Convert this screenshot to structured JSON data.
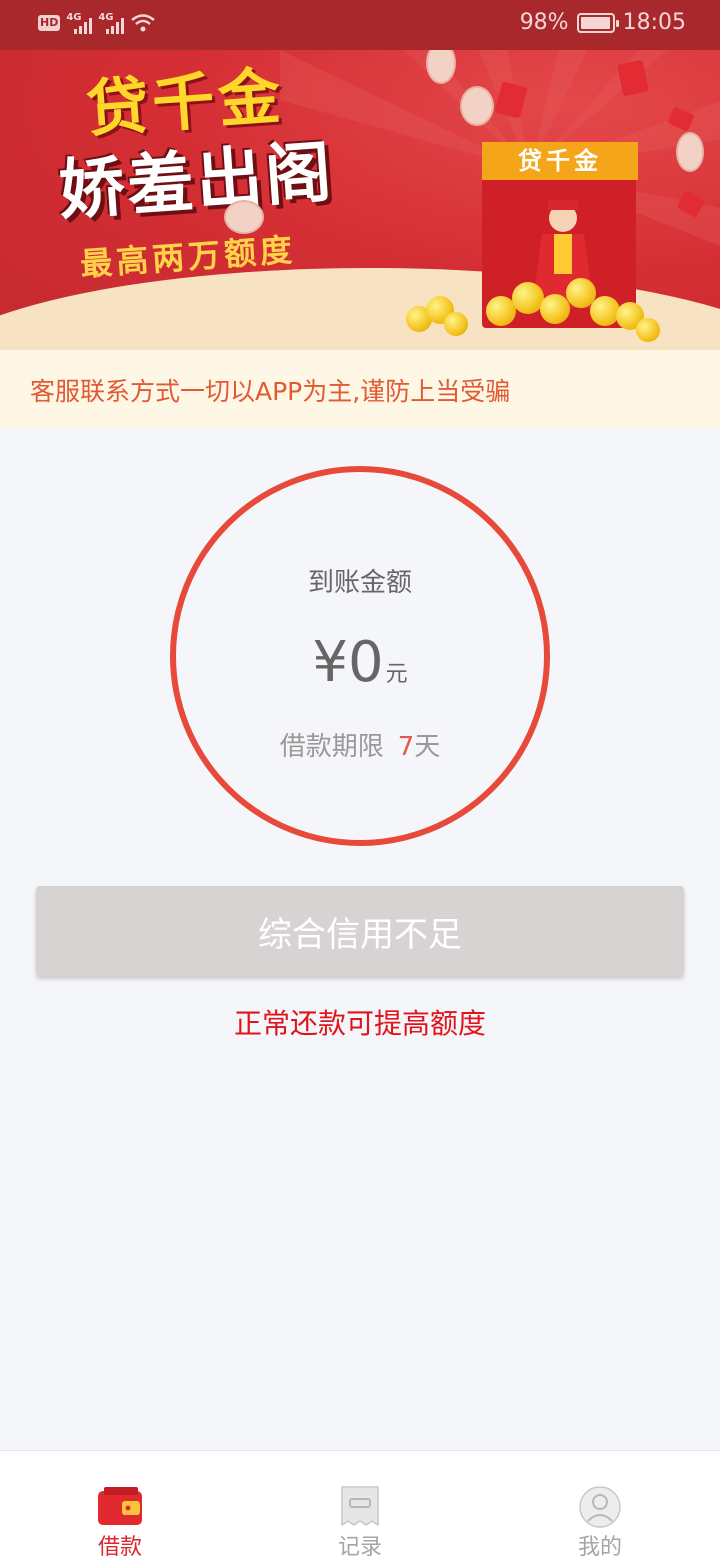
{
  "status_bar": {
    "hd_badge": "HD",
    "network_1": "4G",
    "network_2": "4G",
    "battery_percent": "98%",
    "battery_level": 0.98,
    "time": "18:05"
  },
  "banner": {
    "slogan_line1": "贷千金",
    "slogan_line2": "娇羞出阁",
    "slogan_line3": "最高两万额度",
    "envelope_tag": "贷千金"
  },
  "notice": {
    "text": "客服联系方式一切以APP为主,谨防上当受骗"
  },
  "amount": {
    "label": "到账金额",
    "currency_symbol": "¥",
    "value": "0",
    "unit": "元",
    "term_label": "借款期限",
    "term_value": "7",
    "term_unit": "天"
  },
  "action": {
    "button_label": "综合信用不足",
    "hint": "正常还款可提高额度"
  },
  "tabbar": {
    "items": [
      {
        "label": "借款",
        "icon": "wallet-icon",
        "active": true
      },
      {
        "label": "记录",
        "icon": "record-icon",
        "active": false
      },
      {
        "label": "我的",
        "icon": "profile-icon",
        "active": false
      }
    ]
  },
  "colors": {
    "status_bar_bg": "#a8282c",
    "banner_red": "#d42e34",
    "accent_red": "#e7493a",
    "button_disabled": "#d7d3d3",
    "hint_red": "#e0141b",
    "notice_bg": "#fff7e6"
  }
}
